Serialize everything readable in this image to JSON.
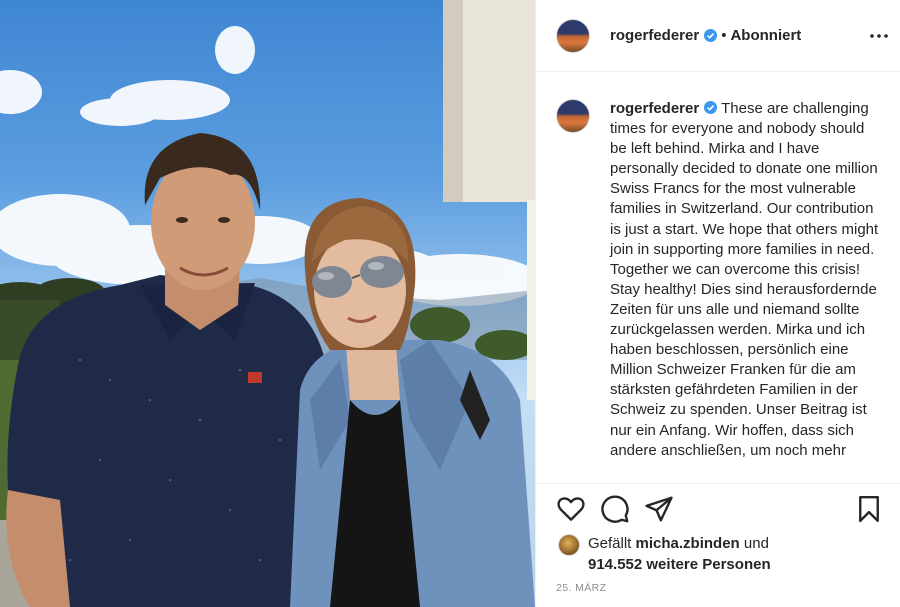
{
  "post": {
    "author": "rogerfederer",
    "follow_status": "Abonniert",
    "separator": "•",
    "more_label": "•••",
    "caption_text": "These are challenging times for everyone and nobody should be left behind. Mirka and I have personally decided to donate one million Swiss Francs for the most vulnerable families in Switzerland. Our contribution is just a start. We hope that others might join in supporting more families in need. Together we can overcome this crisis! Stay healthy! Dies sind herausfordernde Zeiten für uns alle und niemand sollte zurückgelassen werden. Mirka und ich haben beschlossen, persönlich eine Million Schweizer Franken für die am stärksten gefährdeten Familien in der Schweiz zu spenden. Unser Beitrag ist nur ein Anfang. Wir hoffen, dass sich andere anschließen, um noch mehr",
    "likes": {
      "prefix": "Gefällt",
      "user": "micha.zbinden",
      "conj": "und",
      "count": "914.552 weitere Personen"
    },
    "date": "25. MÄRZ"
  },
  "icons": {
    "verified": "verified-badge-icon",
    "like": "heart-icon",
    "comment": "comment-icon",
    "share": "paper-plane-icon",
    "save": "bookmark-icon",
    "more": "more-options-icon"
  },
  "colors": {
    "verified_blue": "#3897f0",
    "text": "#262626",
    "muted": "#8e8e8e",
    "border": "#efefef"
  }
}
